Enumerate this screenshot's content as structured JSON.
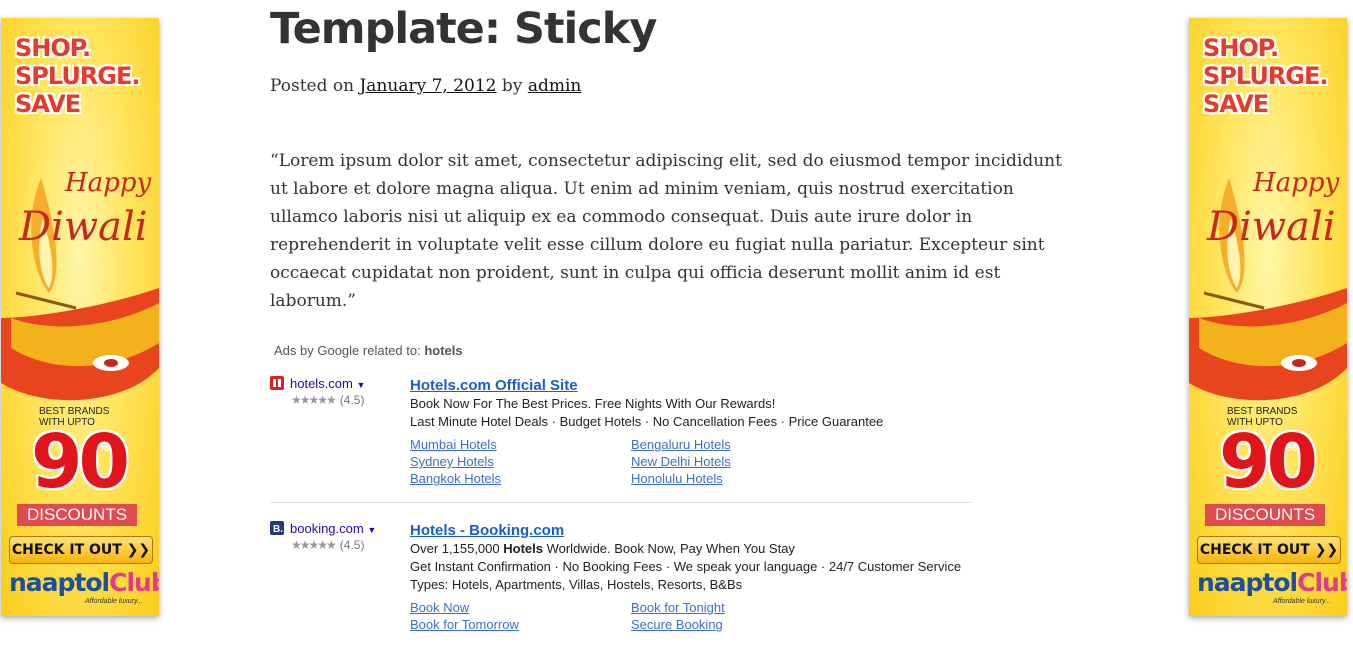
{
  "banner": {
    "shop_lines": [
      "SHOP.",
      "SPLURGE.",
      "SAVE"
    ],
    "happy": "Happy",
    "diwali": "Diwali",
    "best_brands": "BEST BRANDS",
    "with_upto": "WITH UPTO",
    "big_number": "90",
    "percent": "%",
    "discounts": "DISCOUNTS",
    "cta": "CHECK IT OUT ❯❯",
    "logo_a": "naaptol",
    "logo_b": "Club",
    "tagline": "Affordable luxury...",
    "colors": {
      "background": "#f9cd1a",
      "accent": "#e0151b",
      "logo": "#1d4fa0"
    }
  },
  "post": {
    "title": "Template: Sticky",
    "posted_on": "Posted on",
    "date": "January 7, 2012",
    "by": "by",
    "author": "admin",
    "body": "“Lorem ipsum dolor sit amet, consectetur adipiscing elit, sed do eiusmod tempor incididunt ut labore et dolore magna aliqua. Ut enim ad minim veniam, quis nostrud exercitation ullamco laboris nisi ut aliquip ex ea commodo consequat. Duis aute irure dolor in reprehenderit in voluptate velit esse cillum dolore eu fugiat nulla pariatur. Excepteur sint occaecat cupidatat non proident, sunt in culpa qui officia deserunt mollit anim id est laborum.”"
  },
  "ads": {
    "header_prefix": "Ads by Google related to:",
    "header_keyword": "hotels",
    "items": [
      {
        "domain": "hotels.com",
        "rating": "(4.5)",
        "stars": "★★★★★",
        "title": "Hotels.com Official Site",
        "line1": "Book Now For The Best Prices. Free Nights With Our Rewards!",
        "line2": "Last Minute Hotel Deals · Budget Hotels · No Cancellation Fees · Price Guarantee",
        "line3": "",
        "links": [
          "Mumbai Hotels",
          "Bengaluru Hotels",
          "Sydney Hotels",
          "New Delhi Hotels",
          "Bangkok Hotels",
          "Honolulu Hotels"
        ]
      },
      {
        "domain": "booking.com",
        "rating": "(4.5)",
        "stars": "★★★★★",
        "title": "Hotels - Booking.com",
        "line1_pre": "Over 1,155,000 ",
        "line1_bold": "Hotels",
        "line1_post": " Worldwide. Book Now, Pay When You Stay",
        "line2": "Get Instant Confirmation · No Booking Fees · We speak your language · 24/7 Customer Service",
        "line3": "Types: Hotels, Apartments, Villas, Hostels, Resorts, B&Bs",
        "links": [
          "Book Now",
          "Book for Tonight",
          "Book for Tomorrow",
          "Secure Booking"
        ]
      }
    ],
    "colors": {
      "title": "#1a5dc9",
      "link": "#3b6fd0",
      "domain": "#1a0dab"
    }
  }
}
